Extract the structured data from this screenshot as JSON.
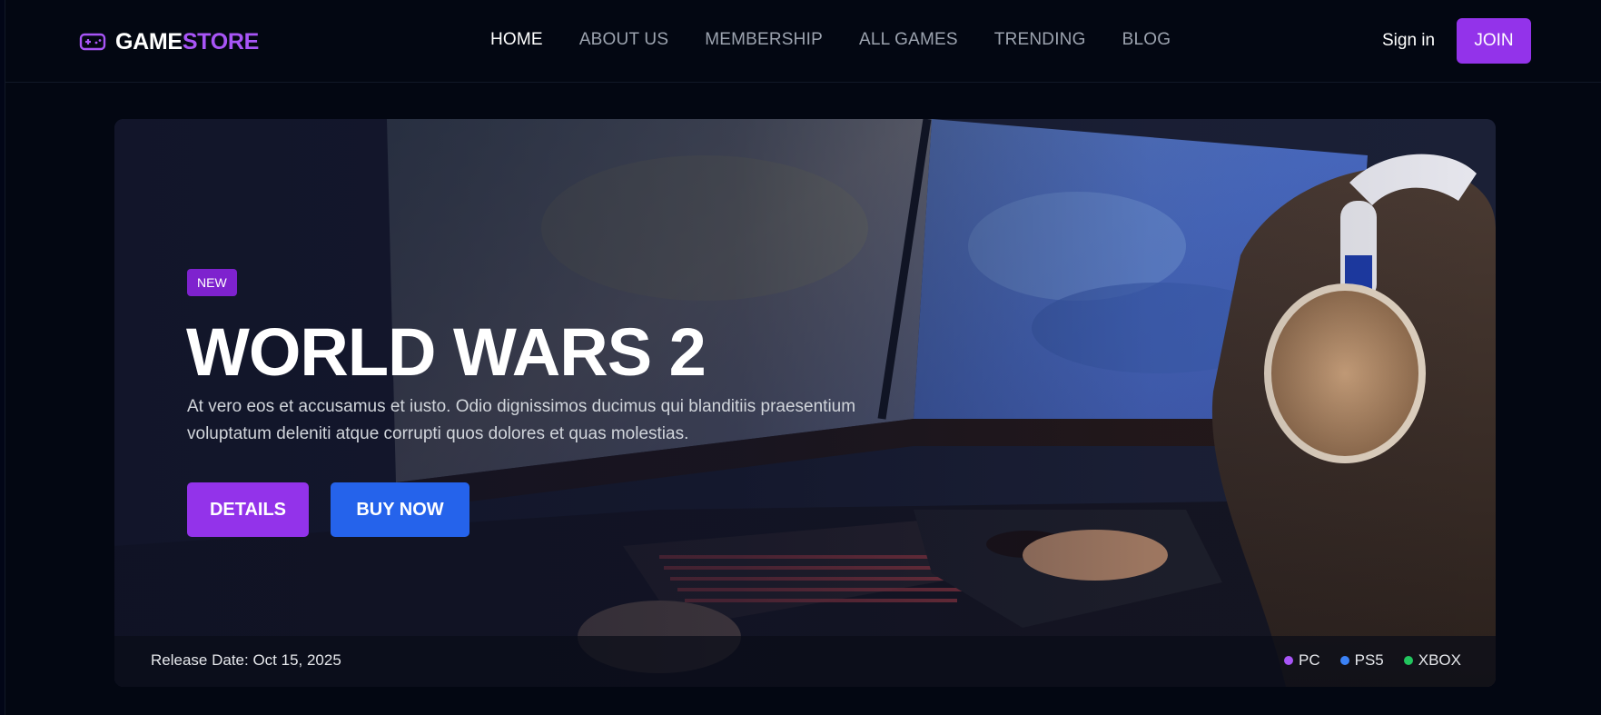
{
  "brand": {
    "part1": "GAME",
    "part2": "STORE",
    "icon": "gamepad-icon",
    "accent": "#a855f7"
  },
  "nav": {
    "items": [
      {
        "label": "HOME",
        "active": true
      },
      {
        "label": "ABOUT US",
        "active": false
      },
      {
        "label": "MEMBERSHIP",
        "active": false
      },
      {
        "label": "ALL GAMES",
        "active": false
      },
      {
        "label": "TRENDING",
        "active": false
      },
      {
        "label": "BLOG",
        "active": false
      }
    ],
    "signin_label": "Sign in",
    "join_label": "JOIN"
  },
  "hero": {
    "badge": "NEW",
    "title": "WORLD WARS 2",
    "description": "At vero eos et accusamus et iusto. Odio dignissimos ducimus qui blanditiis praesentium voluptatum deleniti atque corrupti quos dolores et quas molestias.",
    "details_label": "DETAILS",
    "buy_label": "BUY NOW",
    "release": "Release Date: Oct 15, 2025",
    "platforms": [
      {
        "label": "PC",
        "color": "#a855f7"
      },
      {
        "label": "PS5",
        "color": "#3b82f6"
      },
      {
        "label": "XBOX",
        "color": "#22c55e"
      }
    ]
  },
  "colors": {
    "primary": "#9333ea",
    "secondary": "#2563eb",
    "background": "#030712"
  }
}
